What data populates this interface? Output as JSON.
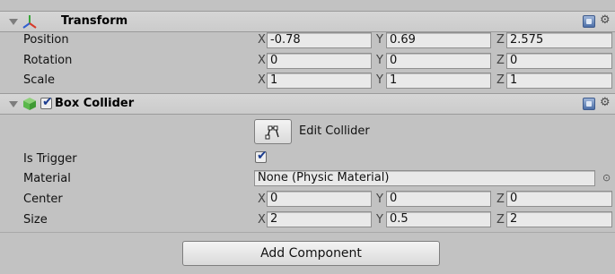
{
  "transform": {
    "title": "Transform",
    "icon": "transform-axes-icon",
    "rows": [
      {
        "label": "Position",
        "x": "-0.78",
        "y": "0.69",
        "z": "2.575"
      },
      {
        "label": "Rotation",
        "x": "0",
        "y": "0",
        "z": "0"
      },
      {
        "label": "Scale",
        "x": "1",
        "y": "1",
        "z": "1"
      }
    ]
  },
  "box_collider": {
    "title": "Box Collider",
    "enabled": true,
    "icon": "cube-icon",
    "edit_collider_label": "Edit Collider",
    "edit_collider_icon": "edit-bounds-icon",
    "is_trigger_label": "Is Trigger",
    "is_trigger_checked": true,
    "material_label": "Material",
    "material_value": "None (Physic Material)",
    "center": {
      "label": "Center",
      "x": "0",
      "y": "0",
      "z": "0"
    },
    "size": {
      "label": "Size",
      "x": "2",
      "y": "0.5",
      "z": "2"
    }
  },
  "axis_labels": {
    "x": "X",
    "y": "Y",
    "z": "Z"
  },
  "add_component_label": "Add Component",
  "colors": {
    "background": "#c2c2c2",
    "header": "#cbcbcb",
    "field": "#e9e9e9",
    "check": "#1b3c8f",
    "help_icon": "#4c6fa8",
    "cube_green": "#5ab84a"
  }
}
